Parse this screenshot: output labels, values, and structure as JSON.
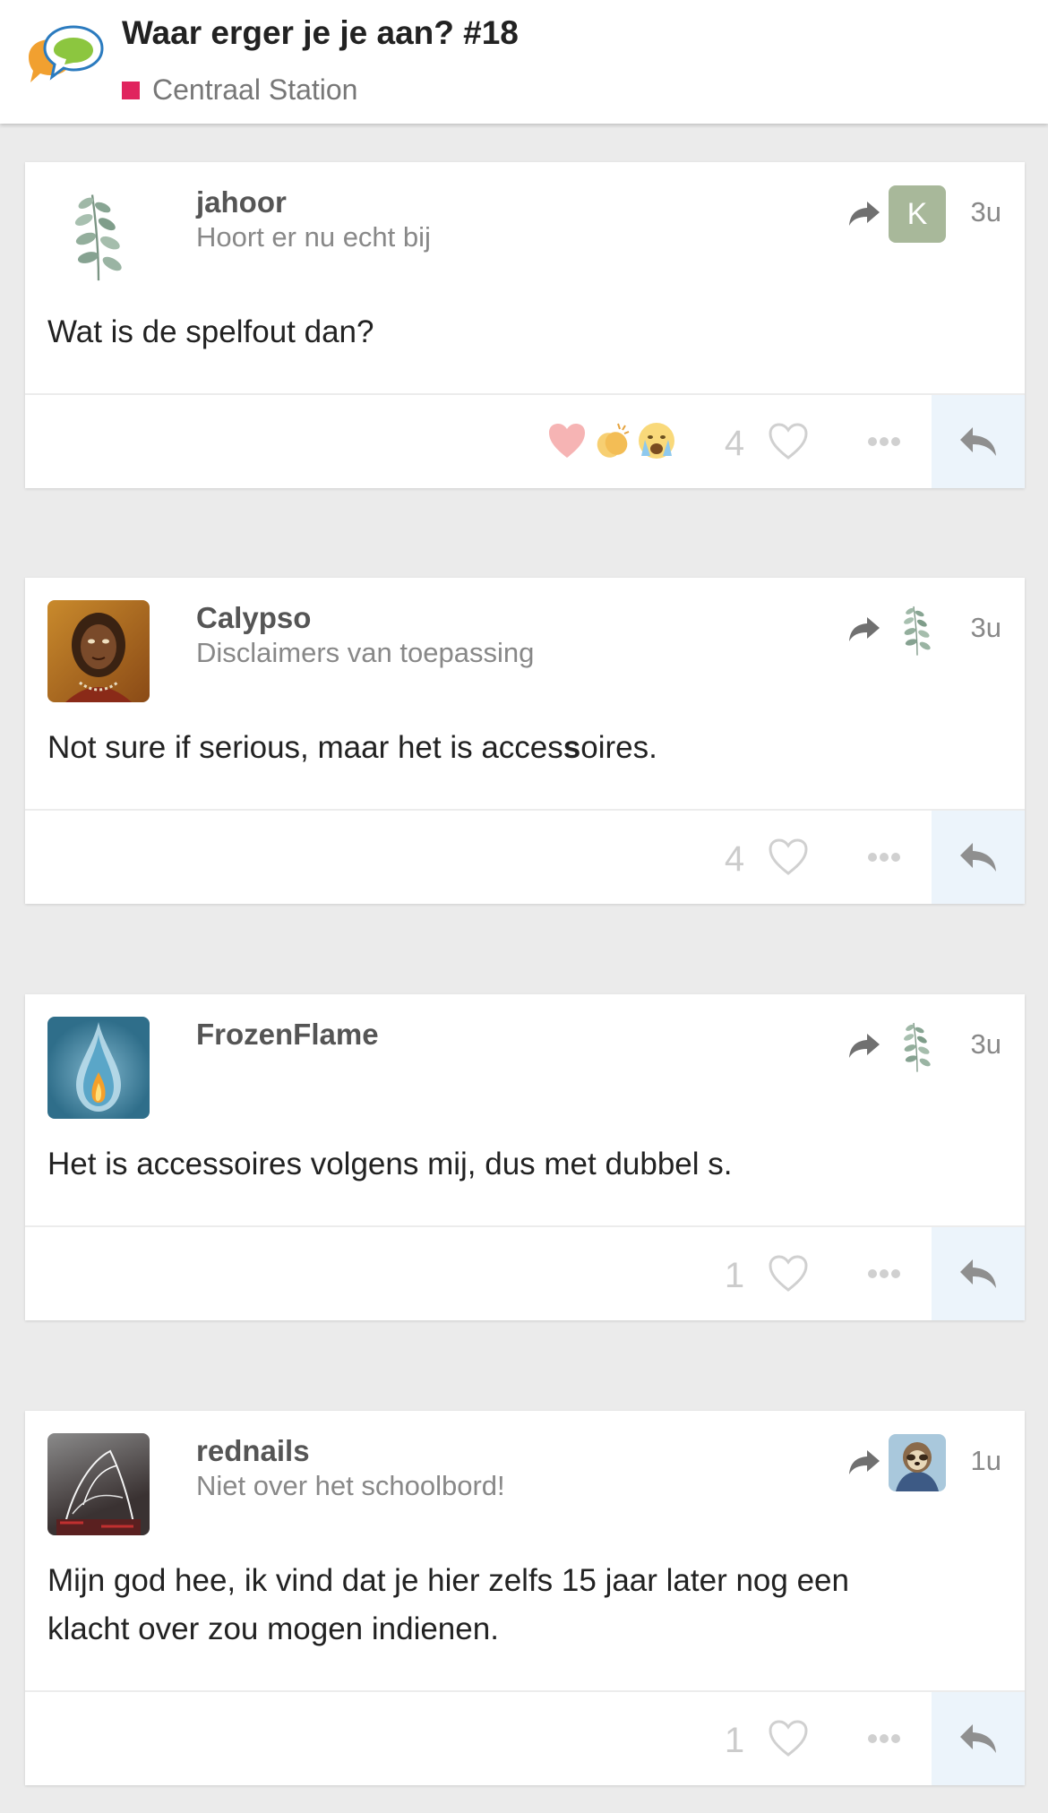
{
  "topic": {
    "title": "Waar erger je je aan? #18",
    "category": "Centraal Station",
    "category_color": "#e0245e"
  },
  "posts": [
    {
      "username": "jahoor",
      "user_title": "Hoort er nu echt bij",
      "avatar": "eucalyptus-branch",
      "reply_to_avatar": "letter-avatar",
      "reply_to_letter": "K",
      "time": "3u",
      "body_lines": [
        "Wat is de spelfout dan?"
      ],
      "reactions": [
        "heart-reaction",
        "clapping-hands-reaction",
        "crying-face-reaction"
      ],
      "like_count": "4"
    },
    {
      "username": "Calypso",
      "user_title": "Disclaimers van toepassing",
      "avatar": "calypso-portrait",
      "reply_to_avatar": "eucalyptus-branch",
      "time": "3u",
      "body_before": "Not sure if serious, maar het is acces",
      "body_bold": "s",
      "body_after": "oires.",
      "like_count": "4"
    },
    {
      "username": "FrozenFlame",
      "user_title": "",
      "avatar": "ice-flame-drop",
      "reply_to_avatar": "eucalyptus-branch",
      "time": "3u",
      "body_lines": [
        "Het is accessoires volgens mij, dus met dubbel s."
      ],
      "like_count": "1"
    },
    {
      "username": "rednails",
      "user_title": "Niet over het schoolbord!",
      "avatar": "light-painting-photo",
      "reply_to_avatar": "sloth-avatar",
      "time": "1u",
      "body_lines": [
        "Mijn god hee, ik vind dat je hier zelfs 15 jaar later nog een",
        "klacht over zou mogen indienen."
      ],
      "like_count": "1"
    }
  ]
}
